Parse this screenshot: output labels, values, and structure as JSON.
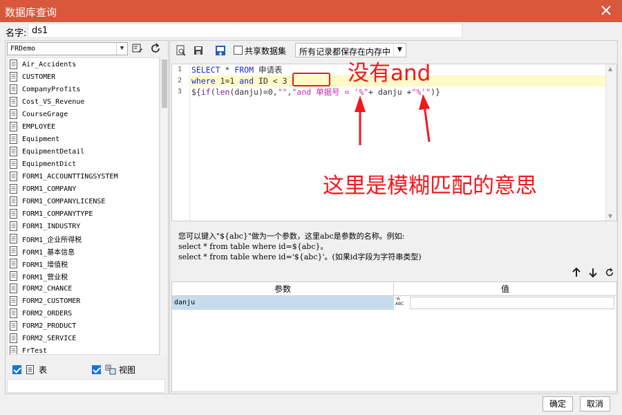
{
  "window": {
    "title": "数据库查询"
  },
  "name_field": {
    "label": "名字:",
    "value": "ds1"
  },
  "left": {
    "database": "FRDemo",
    "tables": [
      "Air_Accidents",
      "CUSTOMER",
      "CompanyProfits",
      "Cost_VS_Revenue",
      "CourseGrage",
      "EMPLOYEE",
      "Equipment",
      "EquipmentDetail",
      "EquipmentDict",
      "FORM1_ACCOUNTTINGSYSTEM",
      "FORM1_COMPANY",
      "FORM1_COMPANYLICENSE",
      "FORM1_COMPANYTYPE",
      "FORM1_INDUSTRY",
      "FORM1_企业所得税",
      "FORM1_基本信息",
      "FORM1_增值税",
      "FORM1_营业税",
      "FORM2_CHANCE",
      "FORM2_CUSTOMER",
      "FORM2_ORDERS",
      "FORM2_PRODUCT",
      "FORM2_SERVICE",
      "FrTest"
    ],
    "show_tables_label": "表",
    "show_views_label": "视图"
  },
  "toolbar": {
    "share_label": "共享数据集",
    "memory_option": "所有记录都保存在内存中"
  },
  "editor": {
    "lines": [
      {
        "num": "1",
        "t1": "SELECT",
        "t2": " * ",
        "t3": "FROM",
        "t4": " 申请表"
      },
      {
        "num": "2",
        "t1": "where",
        "t2": " 1=1 ",
        "t3": "and",
        "t4": " ID < 3"
      },
      {
        "num": "3",
        "t1": "${",
        "t2": "if",
        "t3": "(",
        "t4": "len",
        "t5": "(danju)=0,",
        "t6": "\"\"",
        "t7": ",",
        "t8": "\"and 单据号 = '%\"",
        "t9": "+ danju +",
        "t10": "\"%'\"",
        "t11": ")}"
      }
    ]
  },
  "hint": {
    "line1": "您可以键入\"${abc}\"做为一个参数，这里abc是参数的名称。例如:",
    "line2": "select * from table where id=${abc}。",
    "line3": "select * from table where id='${abc}'。(如果id字段为字符串类型)"
  },
  "params": {
    "header_param": "参数",
    "header_value": "值",
    "rows": [
      {
        "name": "danju",
        "type_top": "ⁿA",
        "type_bottom": "ABC",
        "value": ""
      }
    ]
  },
  "buttons": {
    "ok": "确定",
    "cancel": "取消"
  },
  "annotations": {
    "text1": "没有and",
    "text2": "这里是模糊匹配的意思",
    "color": "#f0181e"
  }
}
